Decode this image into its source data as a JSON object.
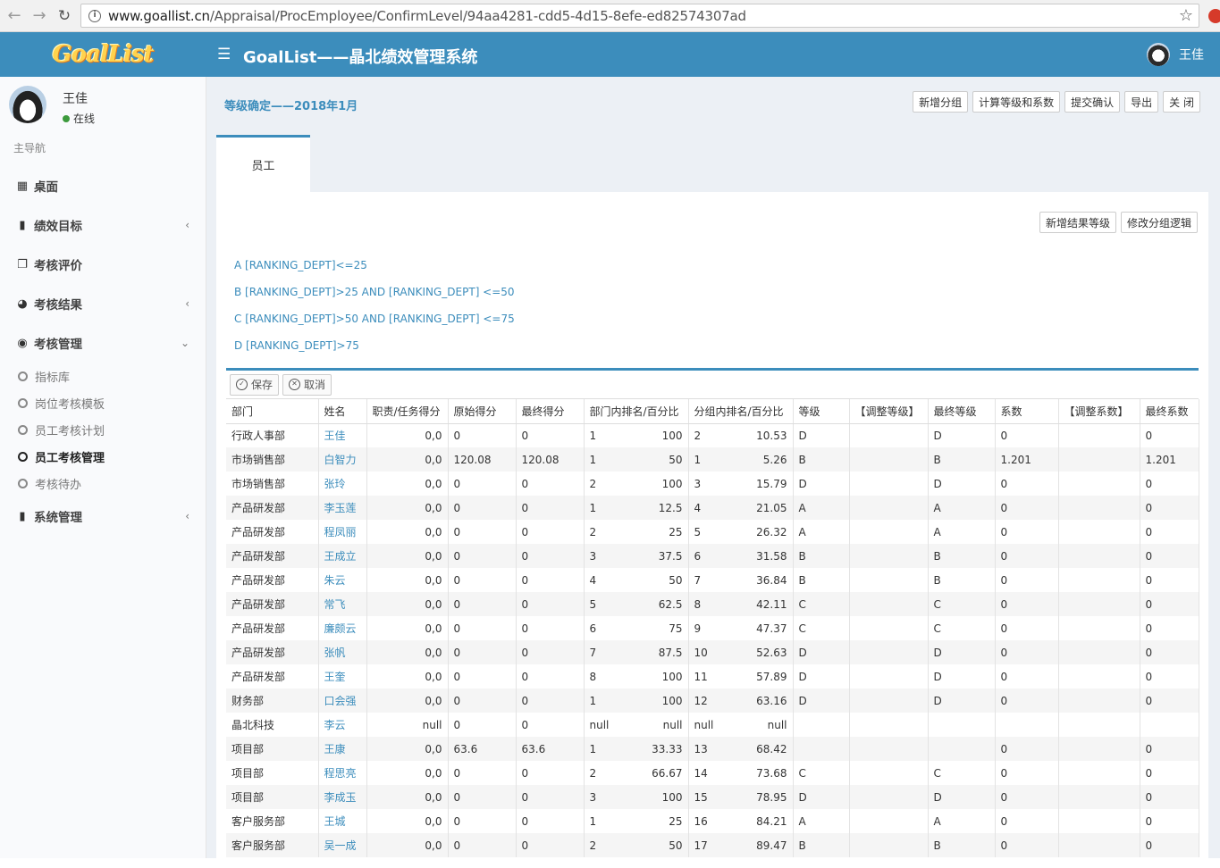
{
  "browser": {
    "url_host": "www.goallist.cn",
    "url_path": "/Appraisal/ProcEmployee/ConfirmLevel/94aa4281-cdd5-4d15-8efe-ed82574307ad"
  },
  "header": {
    "logo_text": "GoalList",
    "title": "GoalList——晶北绩效管理系统",
    "user": "王佳"
  },
  "sidebar": {
    "user_name": "王佳",
    "status": "在线",
    "nav_header": "主导航",
    "items": [
      {
        "label": "桌面",
        "icon": "grid-icon"
      },
      {
        "label": "绩效目标",
        "icon": "book-icon"
      },
      {
        "label": "考核评价",
        "icon": "copy-icon"
      },
      {
        "label": "考核结果",
        "icon": "pie-chart-icon"
      },
      {
        "label": "考核管理",
        "icon": "dashboard-icon"
      },
      {
        "label": "系统管理",
        "icon": "book-icon"
      }
    ],
    "sub_items": [
      {
        "label": "指标库"
      },
      {
        "label": "岗位考核模板"
      },
      {
        "label": "员工考核计划"
      },
      {
        "label": "员工考核管理"
      },
      {
        "label": "考核待办"
      }
    ]
  },
  "page": {
    "title": "等级确定——2018年1月",
    "buttons": [
      "新增分组",
      "计算等级和系数",
      "提交确认",
      "导出",
      "关 闭"
    ],
    "tab": "员工",
    "panel_buttons": [
      "新增结果等级",
      "修改分组逻辑"
    ],
    "rules": [
      "A [RANKING_DEPT]<=25",
      "B [RANKING_DEPT]>25 AND [RANKING_DEPT] <=50",
      "C [RANKING_DEPT]>50 AND [RANKING_DEPT] <=75",
      "D [RANKING_DEPT]>75"
    ],
    "toolbar": {
      "save": "保存",
      "cancel": "取消"
    }
  },
  "table": {
    "columns": [
      "部门",
      "姓名",
      "职责/任务得分",
      "原始得分",
      "最终得分",
      "部门内排名/百分比",
      "分组内排名/百分比",
      "等级",
      "【调整等级】",
      "最终等级",
      "系数",
      "【调整系数】",
      "最终系数"
    ],
    "rows": [
      {
        "dept": "行政人事部",
        "name": "王佳",
        "duty": "0,0",
        "raw": "0",
        "final": "0",
        "drank": "1",
        "dpct": "100",
        "grank": "2",
        "gpct": "10.53",
        "level": "D",
        "adj_level": "",
        "final_level": "D",
        "coef": "0",
        "adj_coef": "",
        "final_coef": "0"
      },
      {
        "dept": "市场销售部",
        "name": "白智力",
        "duty": "0,0",
        "raw": "120.08",
        "final": "120.08",
        "drank": "1",
        "dpct": "50",
        "grank": "1",
        "gpct": "5.26",
        "level": "B",
        "adj_level": "",
        "final_level": "B",
        "coef": "1.201",
        "adj_coef": "",
        "final_coef": "1.201"
      },
      {
        "dept": "市场销售部",
        "name": "张玲",
        "duty": "0,0",
        "raw": "0",
        "final": "0",
        "drank": "2",
        "dpct": "100",
        "grank": "3",
        "gpct": "15.79",
        "level": "D",
        "adj_level": "",
        "final_level": "D",
        "coef": "0",
        "adj_coef": "",
        "final_coef": "0"
      },
      {
        "dept": "产品研发部",
        "name": "李玉莲",
        "duty": "0,0",
        "raw": "0",
        "final": "0",
        "drank": "1",
        "dpct": "12.5",
        "grank": "4",
        "gpct": "21.05",
        "level": "A",
        "adj_level": "",
        "final_level": "A",
        "coef": "0",
        "adj_coef": "",
        "final_coef": "0"
      },
      {
        "dept": "产品研发部",
        "name": "程凤丽",
        "duty": "0,0",
        "raw": "0",
        "final": "0",
        "drank": "2",
        "dpct": "25",
        "grank": "5",
        "gpct": "26.32",
        "level": "A",
        "adj_level": "",
        "final_level": "A",
        "coef": "0",
        "adj_coef": "",
        "final_coef": "0"
      },
      {
        "dept": "产品研发部",
        "name": "王成立",
        "duty": "0,0",
        "raw": "0",
        "final": "0",
        "drank": "3",
        "dpct": "37.5",
        "grank": "6",
        "gpct": "31.58",
        "level": "B",
        "adj_level": "",
        "final_level": "B",
        "coef": "0",
        "adj_coef": "",
        "final_coef": "0"
      },
      {
        "dept": "产品研发部",
        "name": "朱云",
        "duty": "0,0",
        "raw": "0",
        "final": "0",
        "drank": "4",
        "dpct": "50",
        "grank": "7",
        "gpct": "36.84",
        "level": "B",
        "adj_level": "",
        "final_level": "B",
        "coef": "0",
        "adj_coef": "",
        "final_coef": "0"
      },
      {
        "dept": "产品研发部",
        "name": "常飞",
        "duty": "0,0",
        "raw": "0",
        "final": "0",
        "drank": "5",
        "dpct": "62.5",
        "grank": "8",
        "gpct": "42.11",
        "level": "C",
        "adj_level": "",
        "final_level": "C",
        "coef": "0",
        "adj_coef": "",
        "final_coef": "0"
      },
      {
        "dept": "产品研发部",
        "name": "廉颇云",
        "duty": "0,0",
        "raw": "0",
        "final": "0",
        "drank": "6",
        "dpct": "75",
        "grank": "9",
        "gpct": "47.37",
        "level": "C",
        "adj_level": "",
        "final_level": "C",
        "coef": "0",
        "adj_coef": "",
        "final_coef": "0"
      },
      {
        "dept": "产品研发部",
        "name": "张帆",
        "duty": "0,0",
        "raw": "0",
        "final": "0",
        "drank": "7",
        "dpct": "87.5",
        "grank": "10",
        "gpct": "52.63",
        "level": "D",
        "adj_level": "",
        "final_level": "D",
        "coef": "0",
        "adj_coef": "",
        "final_coef": "0"
      },
      {
        "dept": "产品研发部",
        "name": "王奎",
        "duty": "0,0",
        "raw": "0",
        "final": "0",
        "drank": "8",
        "dpct": "100",
        "grank": "11",
        "gpct": "57.89",
        "level": "D",
        "adj_level": "",
        "final_level": "D",
        "coef": "0",
        "adj_coef": "",
        "final_coef": "0"
      },
      {
        "dept": "财务部",
        "name": "口会强",
        "duty": "0,0",
        "raw": "0",
        "final": "0",
        "drank": "1",
        "dpct": "100",
        "grank": "12",
        "gpct": "63.16",
        "level": "D",
        "adj_level": "",
        "final_level": "D",
        "coef": "0",
        "adj_coef": "",
        "final_coef": "0"
      },
      {
        "dept": "晶北科技",
        "name": "李云",
        "duty": "null",
        "raw": "0",
        "final": "0",
        "drank": "null",
        "dpct": "null",
        "grank": "null",
        "gpct": "null",
        "level": "",
        "adj_level": "",
        "final_level": "",
        "coef": "",
        "adj_coef": "",
        "final_coef": ""
      },
      {
        "dept": "项目部",
        "name": "王康",
        "duty": "0,0",
        "raw": "63.6",
        "final": "63.6",
        "drank": "1",
        "dpct": "33.33",
        "grank": "13",
        "gpct": "68.42",
        "level": "",
        "adj_level": "",
        "final_level": "",
        "coef": "0",
        "adj_coef": "",
        "final_coef": "0"
      },
      {
        "dept": "项目部",
        "name": "程思亮",
        "duty": "0,0",
        "raw": "0",
        "final": "0",
        "drank": "2",
        "dpct": "66.67",
        "grank": "14",
        "gpct": "73.68",
        "level": "C",
        "adj_level": "",
        "final_level": "C",
        "coef": "0",
        "adj_coef": "",
        "final_coef": "0"
      },
      {
        "dept": "项目部",
        "name": "李成玉",
        "duty": "0,0",
        "raw": "0",
        "final": "0",
        "drank": "3",
        "dpct": "100",
        "grank": "15",
        "gpct": "78.95",
        "level": "D",
        "adj_level": "",
        "final_level": "D",
        "coef": "0",
        "adj_coef": "",
        "final_coef": "0"
      },
      {
        "dept": "客户服务部",
        "name": "王城",
        "duty": "0,0",
        "raw": "0",
        "final": "0",
        "drank": "1",
        "dpct": "25",
        "grank": "16",
        "gpct": "84.21",
        "level": "A",
        "adj_level": "",
        "final_level": "A",
        "coef": "0",
        "adj_coef": "",
        "final_coef": "0"
      },
      {
        "dept": "客户服务部",
        "name": "吴一成",
        "duty": "0,0",
        "raw": "0",
        "final": "0",
        "drank": "2",
        "dpct": "50",
        "grank": "17",
        "gpct": "89.47",
        "level": "B",
        "adj_level": "",
        "final_level": "B",
        "coef": "0",
        "adj_coef": "",
        "final_coef": "0"
      }
    ]
  }
}
